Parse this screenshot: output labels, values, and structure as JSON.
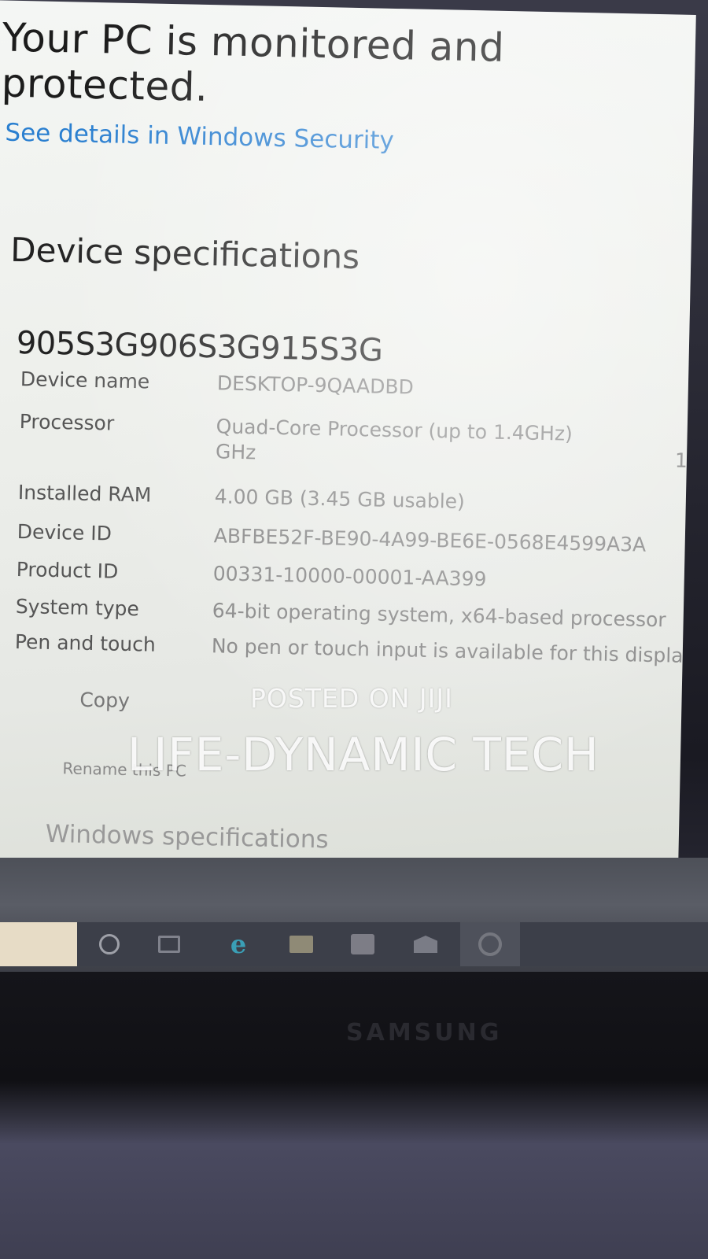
{
  "status": {
    "title": "Your PC is monitored and protected.",
    "link": "See details in Windows Security"
  },
  "device_specs": {
    "section_title": "Device specifications",
    "model": "905S3G906S3G915S3G",
    "rows": [
      {
        "label": "Device name",
        "value": "DESKTOP-9QAADBD"
      },
      {
        "label": "Processor",
        "value": "Quad-Core Processor (up to 1.4GHz) GHz"
      },
      {
        "label": "Installed RAM",
        "value": "4.00 GB (3.45 GB usable)"
      },
      {
        "label": "Device ID",
        "value": "ABFBE52F-BE90-4A99-BE6E-0568E4599A3A"
      },
      {
        "label": "Product ID",
        "value": "00331-10000-00001-AA399"
      },
      {
        "label": "System type",
        "value": "64-bit operating system, x64-based processor"
      },
      {
        "label": "Pen and touch",
        "value": "No pen or touch input is available for this display"
      }
    ],
    "copy_label": "Copy",
    "rename_label": "Rename this PC",
    "edge_fragment": "1"
  },
  "windows_specs": {
    "section_title": "Windows specifications"
  },
  "watermark": {
    "line1": "POSTED ON JIJI",
    "line2": "LIFE-DYNAMIC TECH"
  },
  "taskbar": {
    "icons": [
      "search-icon",
      "task-view-icon",
      "edge-icon",
      "file-explorer-icon",
      "store-icon",
      "mail-icon",
      "settings-icon"
    ],
    "edge_glyph": "e"
  },
  "brand": {
    "name": "SAMSUNG"
  },
  "colors": {
    "link": "#2a7fd0",
    "taskbar": "#3c3f49",
    "start_area": "#e7dcc6"
  }
}
